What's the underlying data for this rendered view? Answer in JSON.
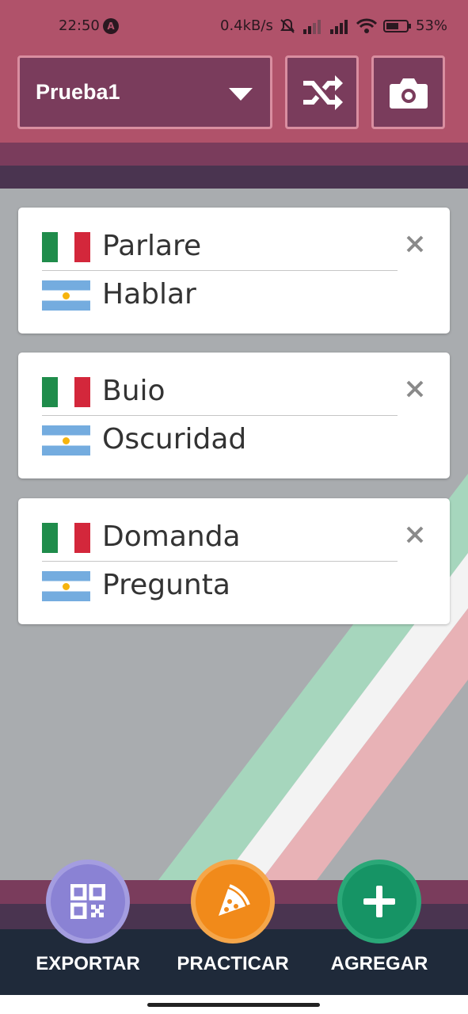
{
  "status_bar": {
    "time": "22:50",
    "network_speed": "0.4kB/s",
    "battery": "53%",
    "icons": [
      "app-a-icon",
      "mute-icon",
      "signal-icon",
      "signal-icon",
      "wifi-icon",
      "battery-icon"
    ]
  },
  "header": {
    "deck_name": "Prueba1",
    "shuffle_icon": "shuffle-icon",
    "camera_icon": "camera-icon"
  },
  "cards": [
    {
      "italian": "Parlare",
      "spanish": "Hablar"
    },
    {
      "italian": "Buio",
      "spanish": "Oscuridad"
    },
    {
      "italian": "Domanda",
      "spanish": "Pregunta"
    }
  ],
  "actions": {
    "export_label": "EXPORTAR",
    "practice_label": "PRACTICAR",
    "add_label": "AGREGAR"
  },
  "colors": {
    "header": "#b0526a",
    "band_dark": "#4a3450",
    "band_mid": "#7a3c5c",
    "background": "#a9acaf",
    "export": "#8a82d4",
    "practice": "#f18a1a",
    "add": "#169465",
    "bottom_bar": "#1f2a3a"
  }
}
